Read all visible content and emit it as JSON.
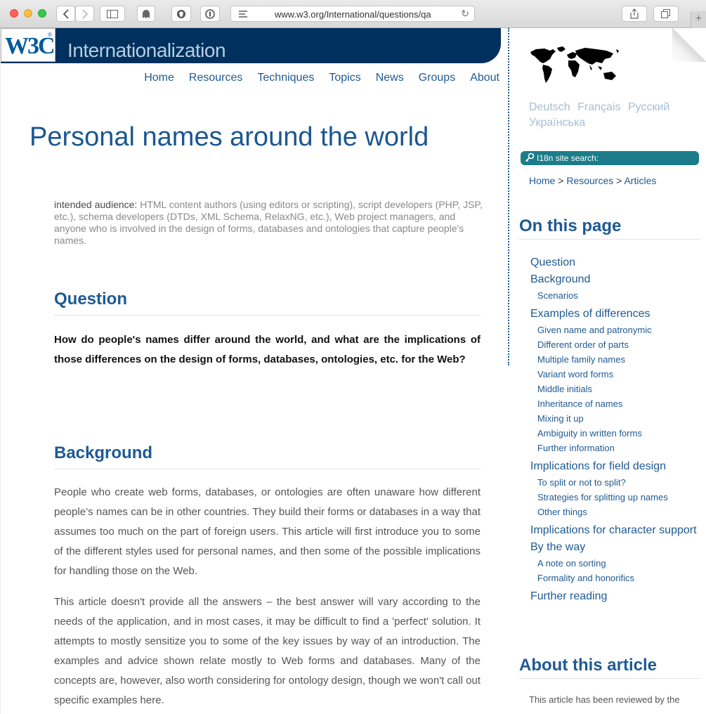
{
  "browser": {
    "url": "www.w3.org/International/questions/qa"
  },
  "site": {
    "logo_text": "W3C",
    "logo_reg": "®",
    "title": "Internationalization"
  },
  "nav": [
    "Home",
    "Resources",
    "Techniques",
    "Topics",
    "News",
    "Groups",
    "About"
  ],
  "article": {
    "title": "Personal names around the world",
    "audience_label": "intended audience:",
    "audience_text": " HTML content authors (using editors or scripting), script developers (PHP, JSP, etc.), schema developers (DTDs, XML Schema, RelaxNG, etc.), Web project managers, and anyone who is involved in the design of forms, databases and ontologies that capture people's names.",
    "question_heading": "Question",
    "question_text": "How do people's names differ around the world, and what are the implications of those differences on the design of forms, databases, ontologies, etc. for the Web?",
    "background_heading": "Background",
    "paragraph1": "People who create web forms, databases, or ontologies are often unaware how different people’s names can be in other countries. They build their forms or databases in a way that assumes too much on the part of foreign users. This article will first introduce you to some of the different styles used for personal names, and then some of the possible implications for handling those on the Web.",
    "paragraph2": "This article doesn't provide all the answers – the best answer will vary according to the needs of the application, and in most cases, it may be difficult to find a 'perfect' solution. It attempts to mostly sensitize you to some of the key issues by way of an introduction. The examples and advice shown relate mostly to Web forms and databases. Many of the concepts are, however, also worth considering for ontology design, though we won't call out specific examples here."
  },
  "sidebar": {
    "languages": [
      "Deutsch",
      "Français",
      "Русский",
      "Українська"
    ],
    "search_label": "I18n site search:",
    "breadcrumb": [
      "Home",
      "Resources",
      "Articles"
    ],
    "breadcrumb_sep": ">",
    "on_this_page": "On this page",
    "toc": [
      {
        "level": 1,
        "label": "Question"
      },
      {
        "level": 1,
        "label": "Background"
      },
      {
        "level": 2,
        "label": "Scenarios"
      },
      {
        "level": 1,
        "label": "Examples of differences"
      },
      {
        "level": 2,
        "label": "Given name and patronymic"
      },
      {
        "level": 2,
        "label": "Different order of parts"
      },
      {
        "level": 2,
        "label": "Multiple family names"
      },
      {
        "level": 2,
        "label": "Variant word forms"
      },
      {
        "level": 2,
        "label": "Middle initials"
      },
      {
        "level": 2,
        "label": "Inheritance of names"
      },
      {
        "level": 2,
        "label": "Mixing it up"
      },
      {
        "level": 2,
        "label": "Ambiguity in written forms"
      },
      {
        "level": 2,
        "label": "Further information"
      },
      {
        "level": 1,
        "label": "Implications for field design"
      },
      {
        "level": 2,
        "label": "To split or not to split?"
      },
      {
        "level": 2,
        "label": "Strategies for splitting up names"
      },
      {
        "level": 2,
        "label": "Other things"
      },
      {
        "level": 1,
        "label": "Implications for character support"
      },
      {
        "level": 1,
        "label": "By the way"
      },
      {
        "level": 2,
        "label": "A note on sorting"
      },
      {
        "level": 2,
        "label": "Formality and honorifics"
      },
      {
        "level": 1,
        "label": "Further reading"
      }
    ],
    "about_heading": "About this article",
    "about_text": "This article has been reviewed by the"
  },
  "colors": {
    "header_blue": "#00305e",
    "link_blue": "#1f5a93",
    "search_teal": "#1c7d8a"
  },
  "icons": [
    "back-arrow-icon",
    "forward-arrow-icon",
    "sidebar-icon",
    "ghost-icon",
    "shield-icon",
    "password-icon",
    "reader-icon",
    "reload-icon",
    "share-icon",
    "tabs-icon",
    "key-icon",
    "world-map-icon"
  ]
}
